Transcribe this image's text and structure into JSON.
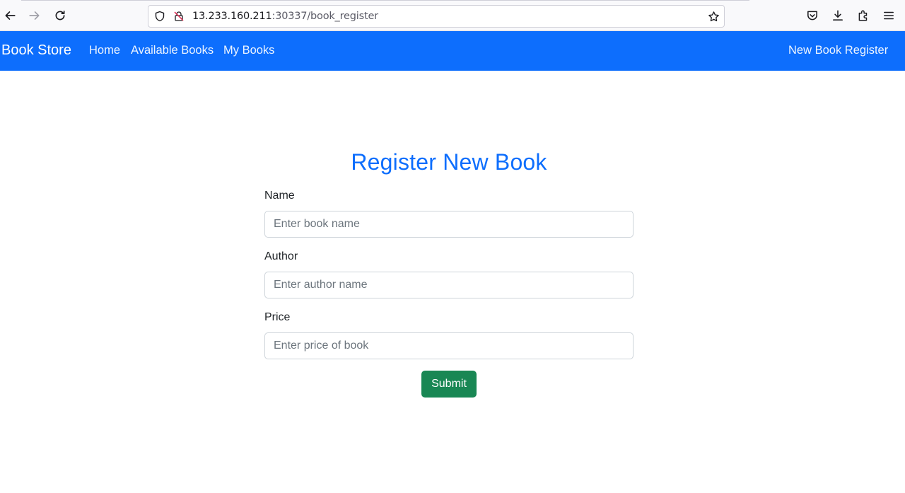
{
  "browser": {
    "url_host": "13.233.160.211",
    "url_rest": ":30337/book_register",
    "icons": [
      "back-icon",
      "forward-icon",
      "reload-icon",
      "shield-icon",
      "insecure-lock-icon",
      "bookmark-star-icon",
      "pocket-icon",
      "downloads-icon",
      "extensions-icon",
      "menu-icon"
    ]
  },
  "navbar": {
    "brand": "Book Store",
    "links": [
      "Home",
      "Available Books",
      "My Books"
    ],
    "right_link": "New Book Register",
    "bg_color": "#0d6efd"
  },
  "form": {
    "title": "Register New Book",
    "fields": [
      {
        "label": "Name",
        "placeholder": "Enter book name",
        "value": ""
      },
      {
        "label": "Author",
        "placeholder": "Enter author name",
        "value": ""
      },
      {
        "label": "Price",
        "placeholder": "Enter price of book",
        "value": ""
      }
    ],
    "submit_label": "Submit",
    "submit_color": "#198754",
    "title_color": "#0d6efd"
  }
}
